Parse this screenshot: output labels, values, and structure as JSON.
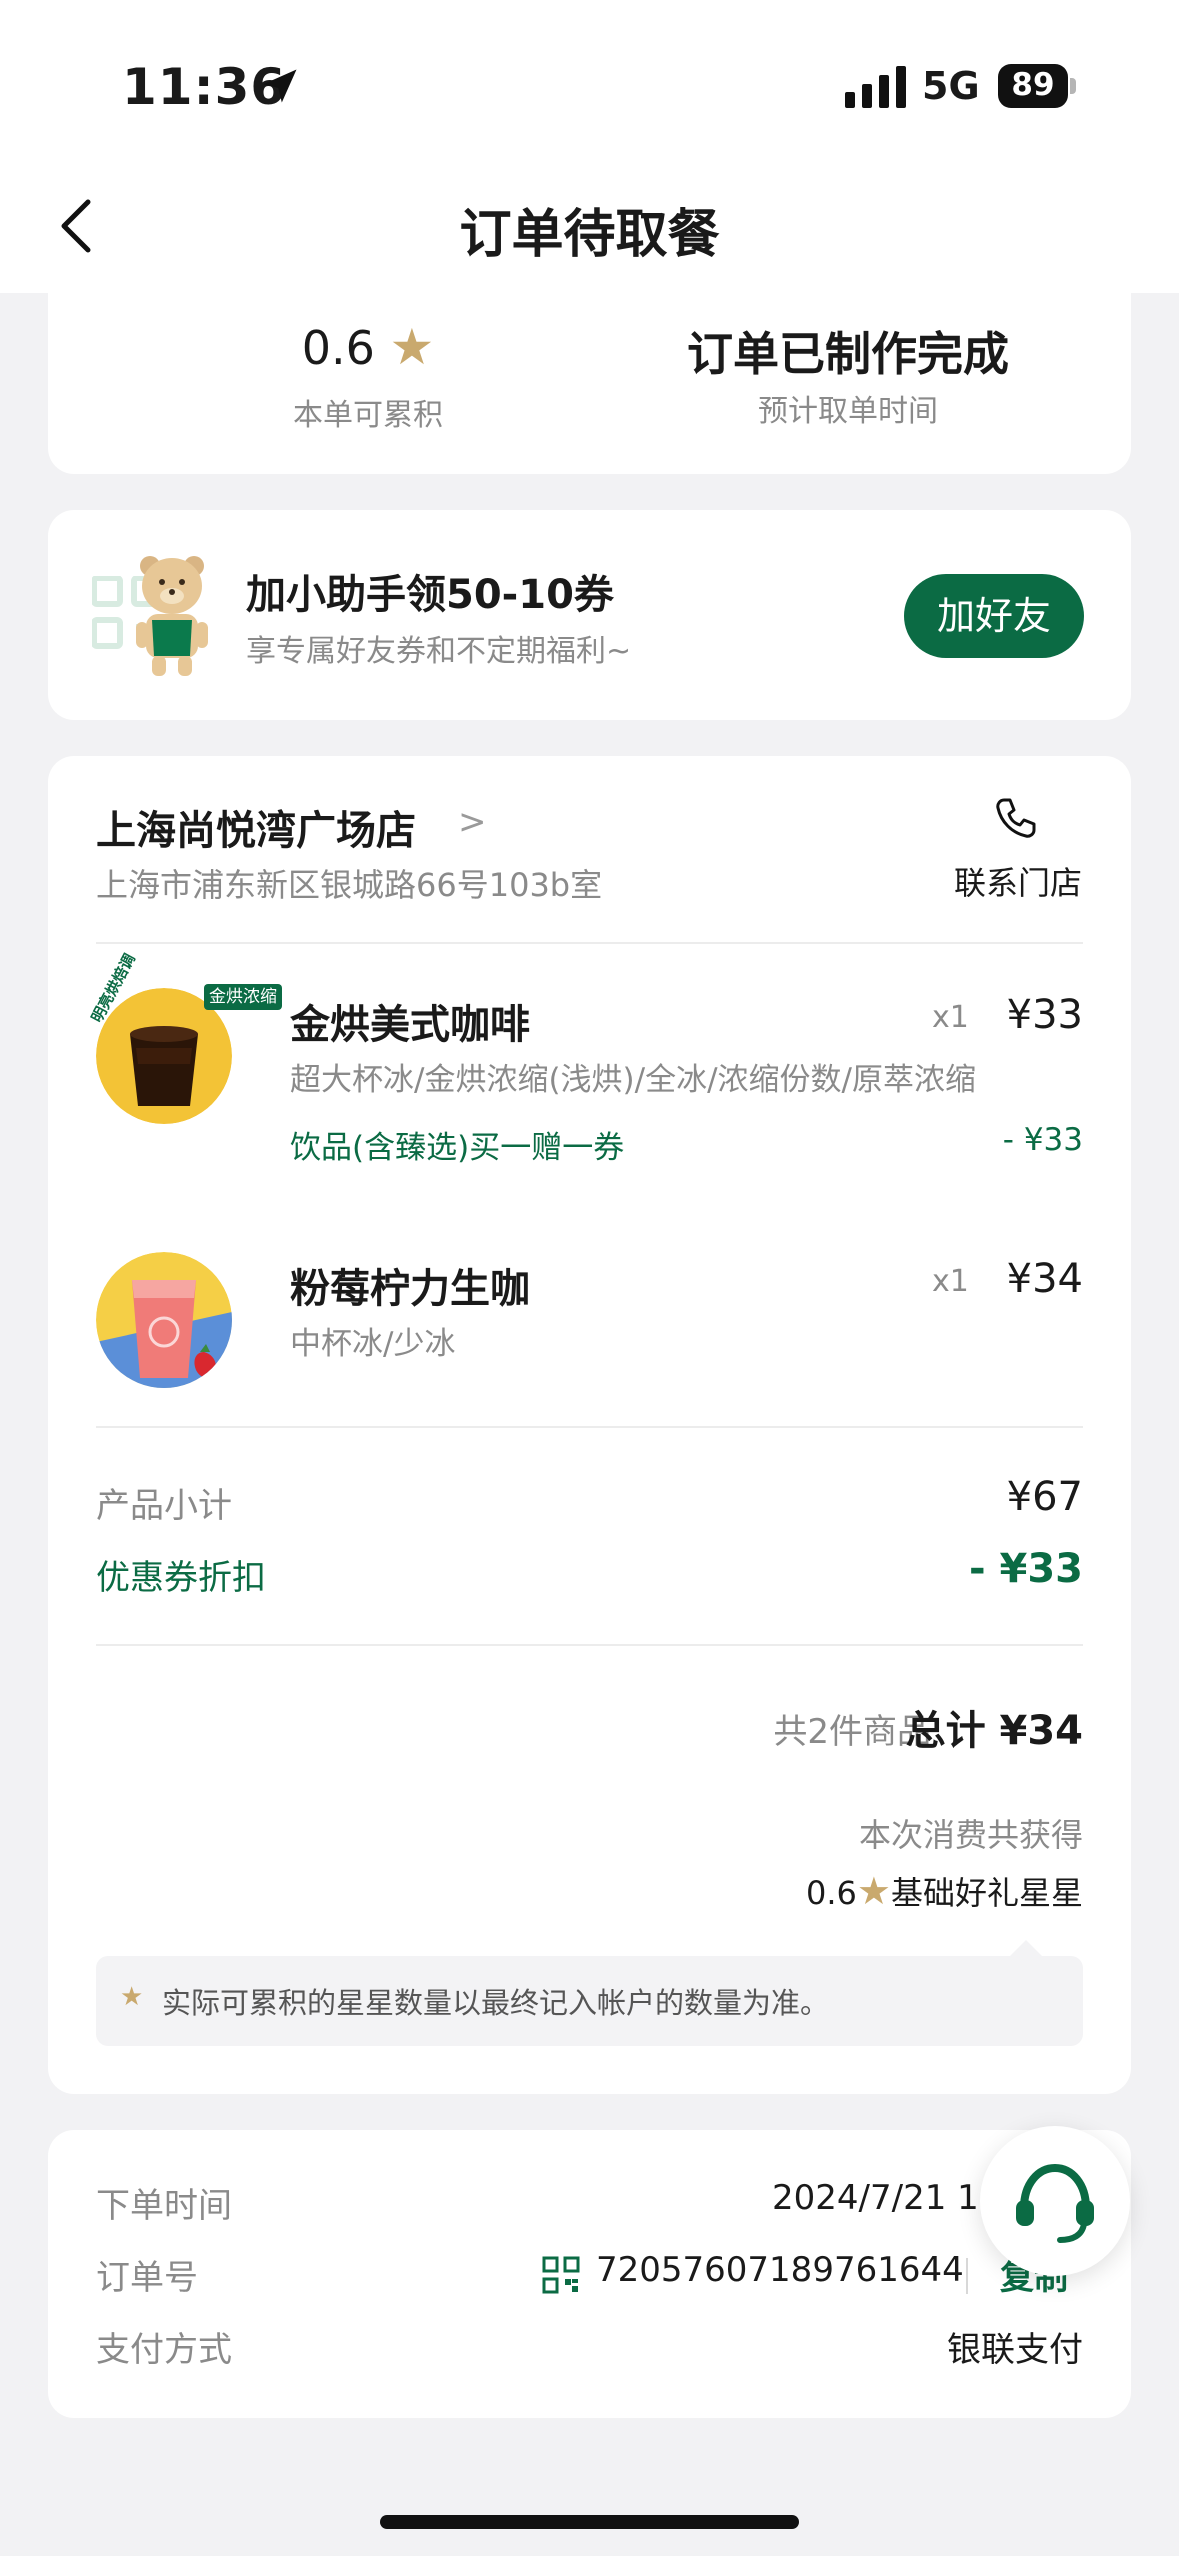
{
  "status_bar": {
    "time": "11:36",
    "network": "5G",
    "battery": "89"
  },
  "nav": {
    "title": "订单待取餐"
  },
  "summary": {
    "stars_value": "0.6",
    "stars_label": "本单可累积",
    "status": "订单已制作完成",
    "status_label": "预计取单时间"
  },
  "promo": {
    "title": "加小助手领50-10券",
    "subtitle": "享专属好友券和不定期福利~",
    "button": "加好友"
  },
  "store": {
    "name": "上海尚悦湾广场店",
    "address": "上海市浦东新区银城路66号103b室",
    "contact": "联系门店"
  },
  "items": [
    {
      "name": "金烘美式咖啡",
      "options": "超大杯冰/金烘浓缩(浅烘)/全冰/浓缩份数/原萃浓缩",
      "qty": "x1",
      "price": "¥33",
      "badge": "金烘浓缩",
      "side_label": "明亮烘焙调",
      "coupon": "饮品(含臻选)买一赠一券",
      "discount": "- ¥33"
    },
    {
      "name": "粉莓柠力生咖",
      "options": "中杯冰/少冰",
      "qty": "x1",
      "price": "¥34"
    }
  ],
  "totals": {
    "subtotal_label": "产品小计",
    "subtotal": "¥67",
    "coupon_label": "优惠券折扣",
    "coupon": "- ¥33",
    "count": "共2件商品",
    "total": "总计 ¥34",
    "earn_label": "本次消费共获得",
    "earn_value": "0.6",
    "earn_unit": "基础好礼星星",
    "note": "实际可累积的星星数量以最终记入帐户的数量为准。"
  },
  "order_info": {
    "time_label": "下单时间",
    "time_value": "2024/7/21 1",
    "id_label": "订单号",
    "id_value": "72057607189761644",
    "copy": "复制",
    "pay_label": "支付方式",
    "pay_value": "银联支付"
  },
  "colors": {
    "brand_green": "#0b6b44",
    "star_gold": "#c9a96e",
    "background": "#f2f2f4"
  },
  "icons": [
    "location-arrow-icon",
    "signal-icon",
    "battery-icon",
    "back-chevron-icon",
    "star-icon",
    "qr-code-icon",
    "phone-icon",
    "customer-service-icon"
  ]
}
